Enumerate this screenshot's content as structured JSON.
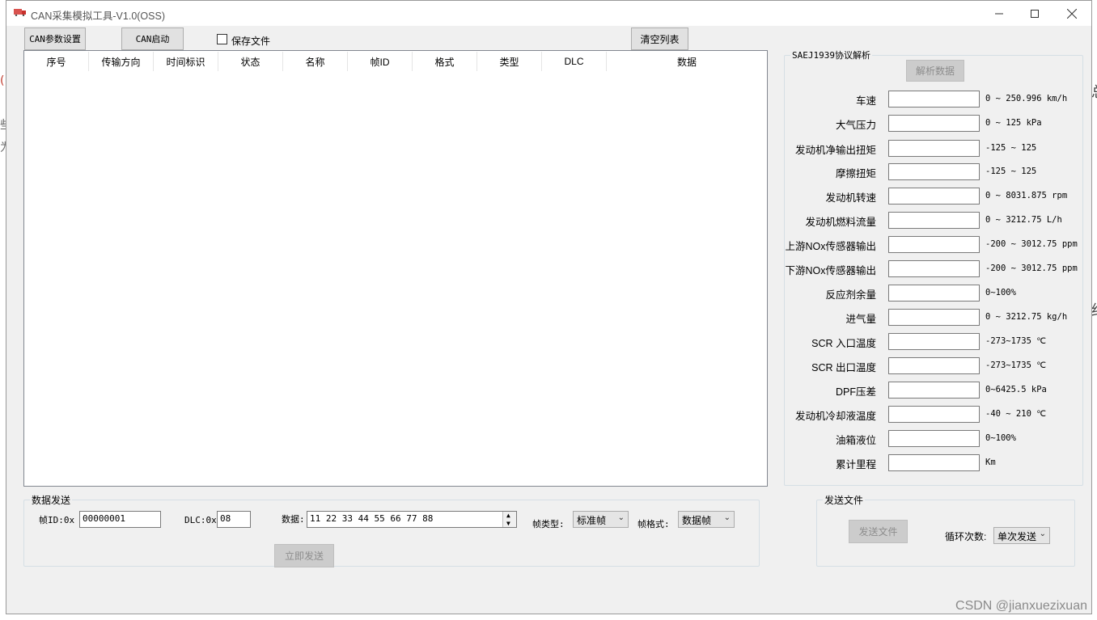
{
  "window": {
    "title": "CAN采集模拟工具-V1.0(OSS)"
  },
  "toolbar": {
    "can_params_label": "CAN参数设置",
    "can_start_label": "CAN启动",
    "save_file_label": "保存文件",
    "save_file_checked": false,
    "clear_list_label": "清空列表"
  },
  "table": {
    "columns": [
      "序号",
      "传输方向",
      "时间标识",
      "状态",
      "名称",
      "帧ID",
      "格式",
      "类型",
      "DLC",
      "数据"
    ],
    "rows": []
  },
  "protocol": {
    "group_title": "SAEJ1939协议解析",
    "parse_button": "解析数据",
    "params": [
      {
        "label": "车速",
        "range": "0 ~ 250.996 km/h",
        "value": ""
      },
      {
        "label": "大气压力",
        "range": "0 ~ 125 kPa",
        "value": ""
      },
      {
        "label": "发动机净输出扭矩",
        "range": "-125 ~ 125",
        "value": ""
      },
      {
        "label": "摩擦扭矩",
        "range": "-125 ~ 125",
        "value": ""
      },
      {
        "label": "发动机转速",
        "range": "0 ~ 8031.875 rpm",
        "value": ""
      },
      {
        "label": "发动机燃料流量",
        "range": "0 ~ 3212.75 L/h",
        "value": ""
      },
      {
        "label": "上游NOx传感器输出",
        "range": "-200 ~ 3012.75 ppm",
        "value": ""
      },
      {
        "label": "下游NOx传感器输出",
        "range": "-200 ~ 3012.75 ppm",
        "value": ""
      },
      {
        "label": "反应剂余量",
        "range": "0~100%",
        "value": ""
      },
      {
        "label": "进气量",
        "range": "0 ~ 3212.75 kg/h",
        "value": ""
      },
      {
        "label": "SCR 入口温度",
        "range": "-273~1735 ℃",
        "value": ""
      },
      {
        "label": "SCR 出口温度",
        "range": "-273~1735 ℃",
        "value": ""
      },
      {
        "label": "DPF压差",
        "range": "0~6425.5 kPa",
        "value": ""
      },
      {
        "label": "发动机冷却液温度",
        "range": "-40 ~ 210 ℃",
        "value": ""
      },
      {
        "label": "油箱液位",
        "range": "0~100%",
        "value": ""
      },
      {
        "label": "累计里程",
        "range": "Km",
        "value": ""
      }
    ]
  },
  "send": {
    "group_title": "数据发送",
    "frame_id_label": "帧ID:0x",
    "frame_id_value": "00000001",
    "dlc_label": "DLC:0x",
    "dlc_value": "08",
    "data_label": "数据:",
    "data_value": "11 22 33 44 55 66 77 88",
    "frame_type_label": "帧类型:",
    "frame_type_value": "标准帧",
    "frame_format_label": "帧格式:",
    "frame_format_value": "数据帧",
    "send_now_label": "立即发送"
  },
  "send_file": {
    "group_title": "发送文件",
    "send_file_label": "发送文件",
    "loop_label": "循环次数:",
    "loop_value": "单次发送"
  },
  "watermark": "CSDN @jianxuezixuan",
  "colors": {
    "window_bg": "#f0f0f0",
    "disabled_text": "#8d8d8d",
    "border": "#adadad"
  }
}
